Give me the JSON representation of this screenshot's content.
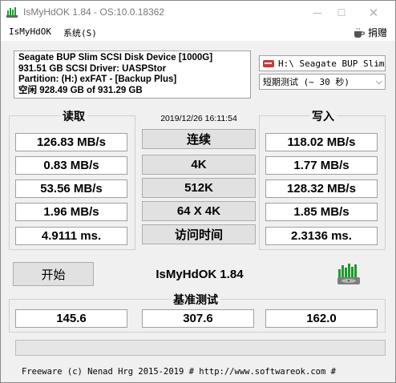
{
  "window": {
    "title": "IsMyHdOK 1.84 - OS:10.0.18362"
  },
  "menu": {
    "items": [
      "IsMyHdOK",
      "系统(S)"
    ],
    "donate_label": "捐赠"
  },
  "device": {
    "lines": [
      "Seagate BUP Slim SCSI Disk Device [1000G]",
      "931.51 GB  SCSI Driver: UASPStor",
      "Partition: (H:) exFAT - [Backup Plus]",
      "空闲 928.49 GB of 931.29 GB"
    ],
    "drive_select": "H:\\ Seagate BUP Slim",
    "test_select": "短期测试 (~ 30 秒)"
  },
  "read": {
    "title": "读取",
    "values": [
      "126.83 MB/s",
      "0.83 MB/s",
      "53.56 MB/s",
      "1.96 MB/s",
      "4.9111 ms."
    ]
  },
  "write": {
    "title": "写入",
    "values": [
      "118.02 MB/s",
      "1.77 MB/s",
      "128.32 MB/s",
      "1.85 MB/s",
      "2.3136 ms."
    ]
  },
  "timestamp": "2019/12/26 16:11:54",
  "modes": [
    "连续",
    "4K",
    "512K",
    "64 X 4K",
    "访问时间"
  ],
  "start_label": "开始",
  "app_name": "IsMyHdOK 1.84",
  "benchmark": {
    "title": "基准测试",
    "values": [
      "145.6",
      "307.6",
      "162.0"
    ]
  },
  "progress": 0,
  "footer": "Freeware (c) Nenad Hrg 2015-2019 # http://www.softwareok.com    #",
  "colors": {
    "progress_fill": "#06b025",
    "logo_green": "#1f9a2e"
  }
}
